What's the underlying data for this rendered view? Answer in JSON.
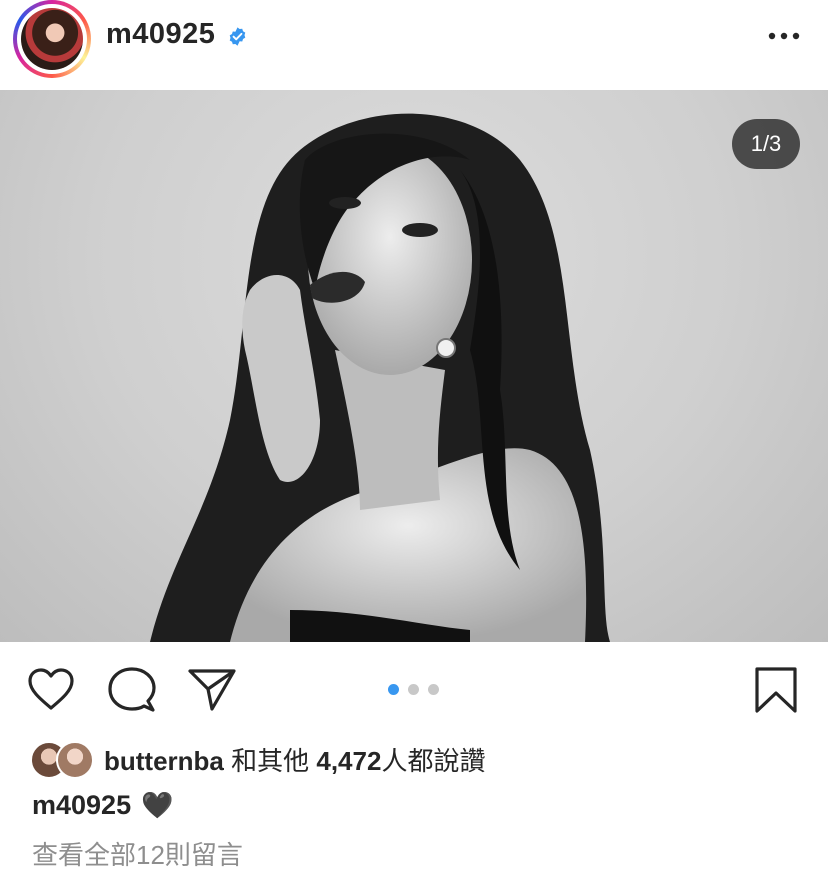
{
  "header": {
    "username": "m40925",
    "verified_icon": "verified-badge-icon",
    "more_icon": "more-options-icon"
  },
  "post": {
    "image_counter": "1/3",
    "carousel": {
      "total": 3,
      "active_index": 0
    }
  },
  "actions": {
    "like_icon": "heart-outline-icon",
    "comment_icon": "comment-bubble-icon",
    "share_icon": "paper-plane-icon",
    "save_icon": "bookmark-icon"
  },
  "likes": {
    "user": "butternba",
    "connector": "和其他",
    "count": "4,472",
    "suffix": "人都說讚"
  },
  "caption": {
    "username": "m40925",
    "emoji": "🖤"
  },
  "comments": {
    "view_all": "查看全部12則留言"
  },
  "colors": {
    "accent_blue": "#3897f0",
    "text": "#262626",
    "muted": "#8e8e8e"
  }
}
